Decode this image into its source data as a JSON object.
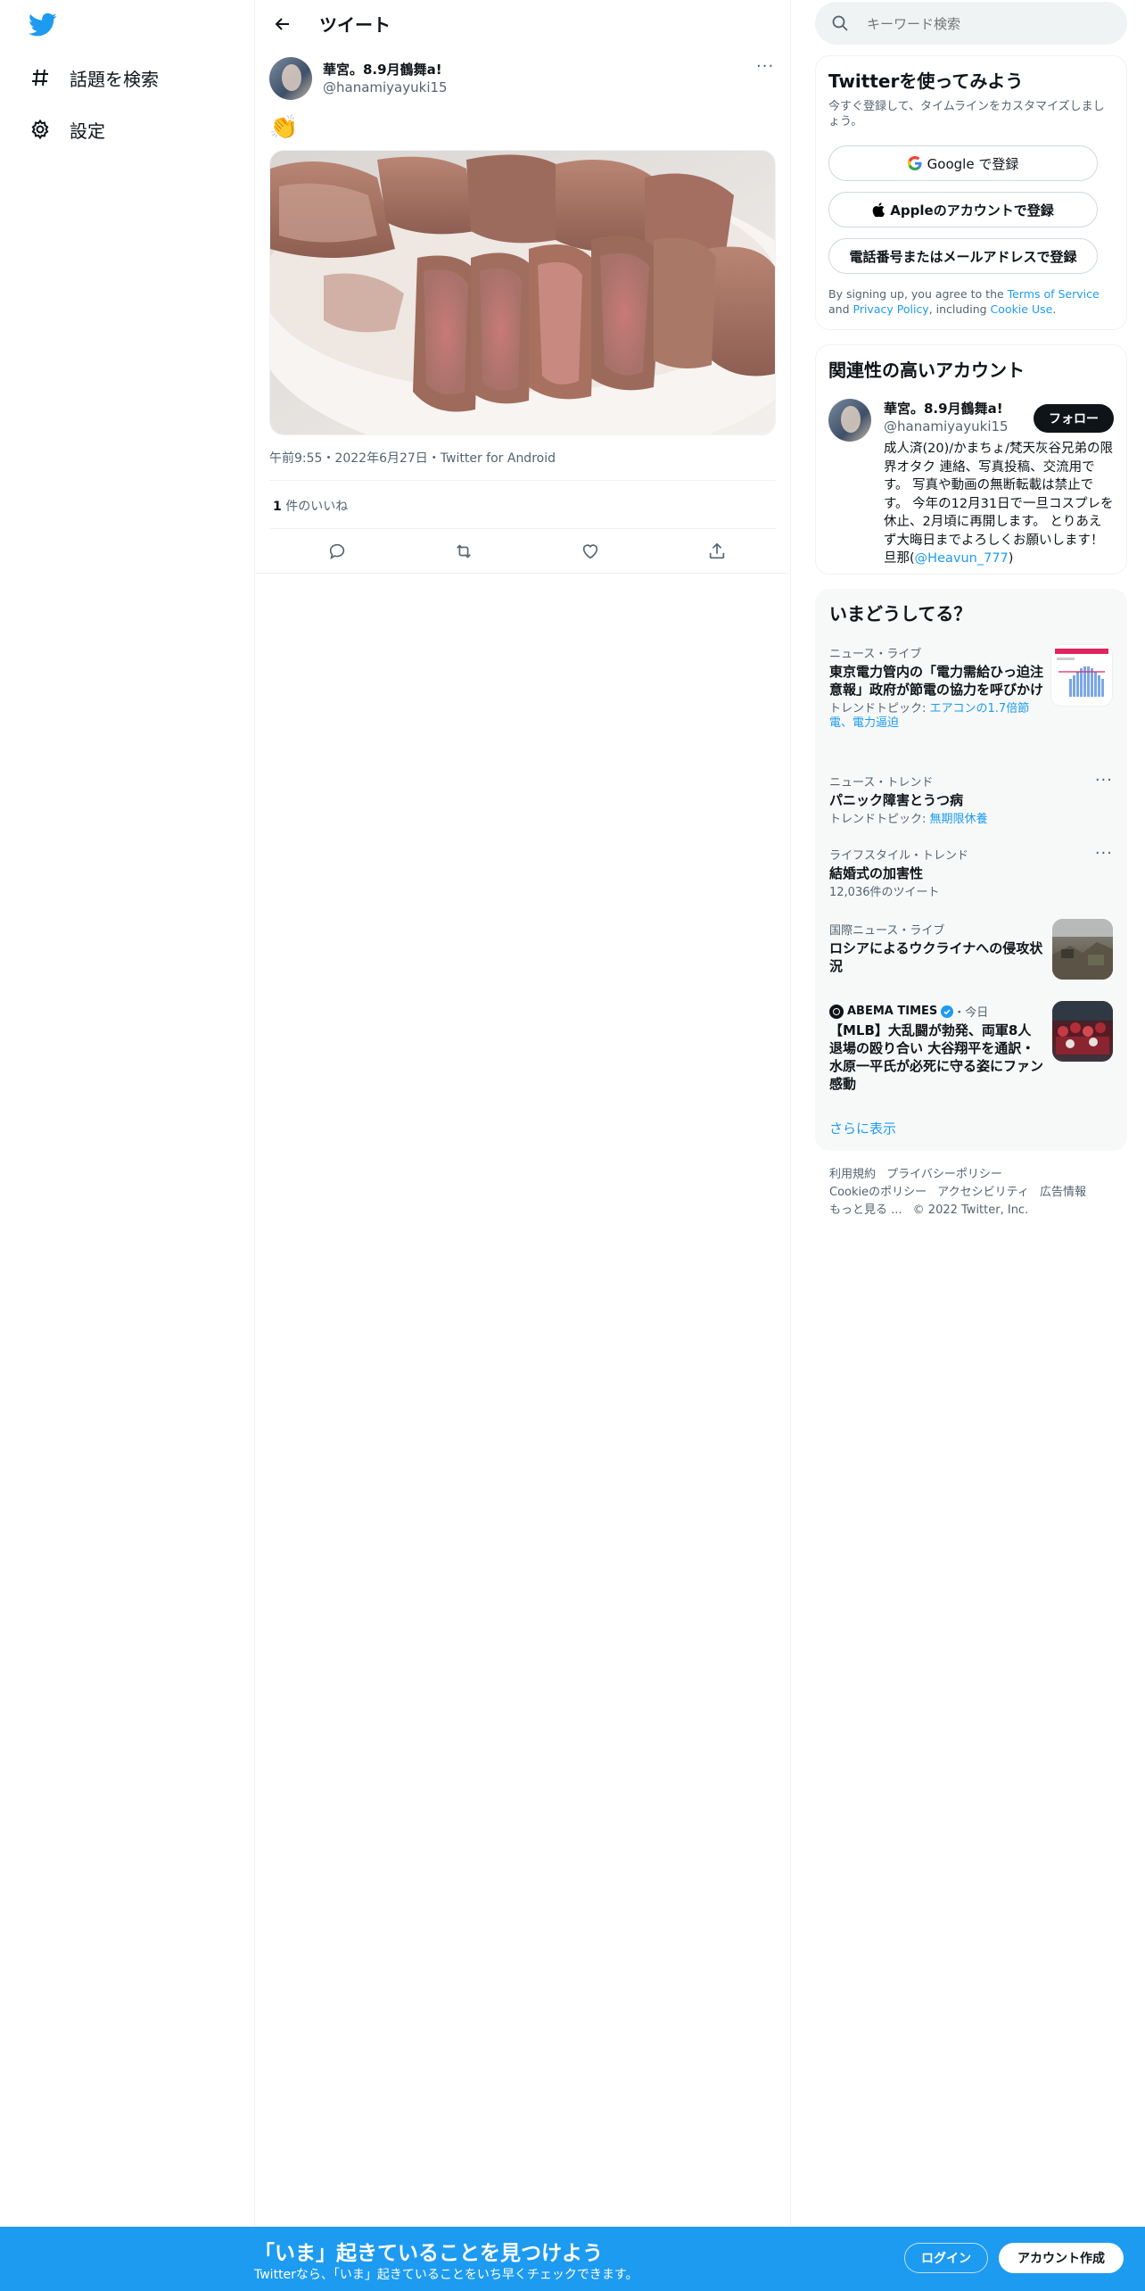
{
  "nav": {
    "explore_label": "話題を検索",
    "settings_label": "設定"
  },
  "header": {
    "title": "ツイート"
  },
  "tweet": {
    "display_name": "華宮。8.9月鶴舞a!",
    "handle": "@hanamiyayuki15",
    "text": "👏",
    "meta": "午前9:55・2022年6月27日・Twitter for Android",
    "likes_count": "1",
    "likes_label": "件のいいね"
  },
  "search": {
    "placeholder": "キーワード検索"
  },
  "signup": {
    "title": "Twitterを使ってみよう",
    "subtitle": "今すぐ登録して、タイムラインをカスタマイズしましょう。",
    "google_label": "Google で登録",
    "apple_label": "Appleのアカウントで登録",
    "phone_label": "電話番号またはメールアドレスで登録",
    "legal_prefix": "By signing up, you agree to the ",
    "terms_link": "Terms of Service",
    "legal_and": " and ",
    "privacy_link": "Privacy Policy",
    "legal_including": ", including ",
    "cookie_link": "Cookie Use",
    "legal_end": "."
  },
  "related": {
    "title": "関連性の高いアカウント",
    "display_name": "華宮。8.9月鶴舞a!",
    "handle": "@hanamiyayuki15",
    "follow_label": "フォロー",
    "bio": "成人済(20)/かまちょ/梵天灰谷兄弟の限界オタク 連絡、写真投稿、交流用です。 写真や動画の無断転載は禁止です。 今年の12月31日で一旦コスプレを休止、2月頃に再開します。 とりあえず大晦日までよろしくお願いします！ 旦那(",
    "bio_link": "@Heavun_777",
    "bio_end": ")"
  },
  "trends": {
    "title": "いまどうしてる？",
    "items": [
      {
        "category": "ニュース・ライブ",
        "title": "東京電力管内の「電力需給ひっ迫注意報」政府が節電の協力を呼びかけ",
        "sub_prefix": "トレンドトピック: ",
        "sub_link": "エアコンの1.7倍節電、電力逼迫"
      },
      {
        "category": "ニュース・トレンド",
        "title": "パニック障害とうつ病",
        "sub_prefix": "トレンドトピック: ",
        "sub_link": "無期限休養"
      },
      {
        "category": "ライフスタイル・トレンド",
        "title": "結婚式の加害性",
        "sub_text": "12,036件のツイート"
      },
      {
        "category": "国際ニュース・ライブ",
        "title": "ロシアによるウクライナへの侵攻状況"
      },
      {
        "source": "ABEMA TIMES",
        "time": "・今日",
        "title": "【MLB】大乱闘が勃発、両軍8人退場の殴り合い 大谷翔平を通訳・水原一平氏が必死に守る姿にファン感動"
      }
    ],
    "show_more": "さらに表示"
  },
  "footer": {
    "links_row1": [
      "利用規約",
      "プライバシーポリシー"
    ],
    "links_row2": [
      "Cookieのポリシー",
      "アクセシビリティ",
      "広告情報"
    ],
    "more": "もっと見る ...",
    "copyright": "© 2022 Twitter, Inc."
  },
  "bottom_bar": {
    "headline": "「いま」起きていることを見つけよう",
    "sub": "Twitterなら、「いま」起きていることをいち早くチェックできます。",
    "login_label": "ログイン",
    "signup_label": "アカウント作成"
  },
  "colors": {
    "brand": "#1d9bf0",
    "text": "#0f1419",
    "muted": "#536471",
    "border": "#eff3f4"
  }
}
